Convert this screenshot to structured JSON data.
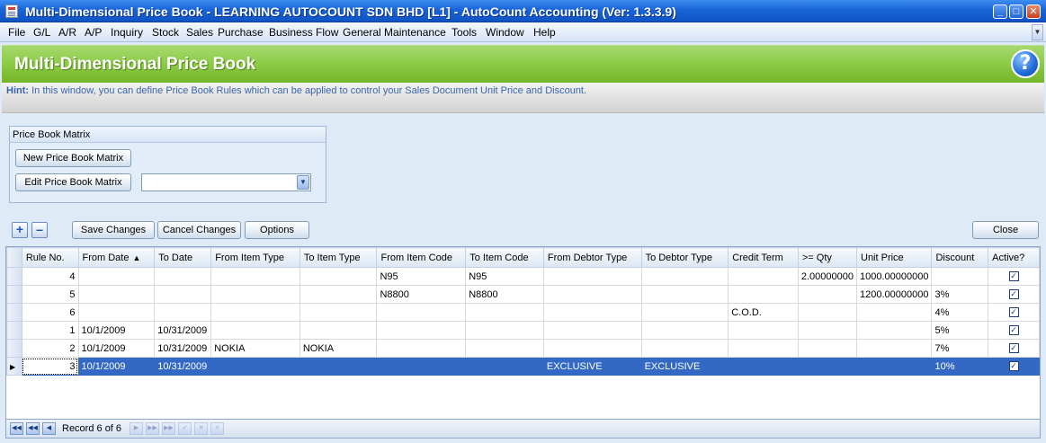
{
  "window": {
    "title": "Multi-Dimensional Price Book - LEARNING AUTOCOUNT SDN BHD [L1] - AutoCount Accounting (Ver: 1.3.3.9)"
  },
  "menu": [
    {
      "label": "File"
    },
    {
      "label": "G/L"
    },
    {
      "label": "A/R"
    },
    {
      "label": "A/P"
    },
    {
      "label": "Inquiry"
    },
    {
      "label": "Stock"
    },
    {
      "label": "Sales"
    },
    {
      "label": "Purchase"
    },
    {
      "label": "Business Flow"
    },
    {
      "label": "General Maintenance"
    },
    {
      "label": "Tools"
    },
    {
      "label": "Window"
    },
    {
      "label": "Help"
    }
  ],
  "header": {
    "title": "Multi-Dimensional Price Book",
    "hint_label": "Hint:",
    "hint_text": "In this window, you can define Price Book Rules which can be applied to control your Sales Document Unit Price and Discount."
  },
  "matrix": {
    "group_title": "Price Book Matrix",
    "new_button": "New Price Book Matrix",
    "edit_button": "Edit Price Book Matrix",
    "selected_matrix": ""
  },
  "toolbar": {
    "add_symbol": "+",
    "remove_symbol": "–",
    "save": "Save Changes",
    "cancel": "Cancel Changes",
    "options": "Options",
    "close": "Close"
  },
  "grid": {
    "columns": [
      "Rule No.",
      "From Date",
      "To Date",
      "From Item Type",
      "To Item Type",
      "From Item Code",
      "To Item Code",
      "From Debtor Type",
      "To Debtor Type",
      "Credit Term",
      ">= Qty",
      "Unit Price",
      "Discount",
      "Active?"
    ],
    "rows": [
      {
        "rule": "4",
        "from_date": "",
        "to_date": "",
        "from_item_type": "",
        "to_item_type": "",
        "from_item_code": "N95",
        "to_item_code": "N95",
        "from_debtor_type": "",
        "to_debtor_type": "",
        "credit_term": "",
        "qty": "2.00000000",
        "unit_price": "1000.00000000",
        "discount": "",
        "active": true
      },
      {
        "rule": "5",
        "from_date": "",
        "to_date": "",
        "from_item_type": "",
        "to_item_type": "",
        "from_item_code": "N8800",
        "to_item_code": "N8800",
        "from_debtor_type": "",
        "to_debtor_type": "",
        "credit_term": "",
        "qty": "",
        "unit_price": "1200.00000000",
        "discount": "3%",
        "active": true
      },
      {
        "rule": "6",
        "from_date": "",
        "to_date": "",
        "from_item_type": "",
        "to_item_type": "",
        "from_item_code": "",
        "to_item_code": "",
        "from_debtor_type": "",
        "to_debtor_type": "",
        "credit_term": "C.O.D.",
        "qty": "",
        "unit_price": "",
        "discount": "4%",
        "active": true
      },
      {
        "rule": "1",
        "from_date": "10/1/2009",
        "to_date": "10/31/2009",
        "from_item_type": "",
        "to_item_type": "",
        "from_item_code": "",
        "to_item_code": "",
        "from_debtor_type": "",
        "to_debtor_type": "",
        "credit_term": "",
        "qty": "",
        "unit_price": "",
        "discount": "5%",
        "active": true
      },
      {
        "rule": "2",
        "from_date": "10/1/2009",
        "to_date": "10/31/2009",
        "from_item_type": "NOKIA",
        "to_item_type": "NOKIA",
        "from_item_code": "",
        "to_item_code": "",
        "from_debtor_type": "",
        "to_debtor_type": "",
        "credit_term": "",
        "qty": "",
        "unit_price": "",
        "discount": "7%",
        "active": true
      },
      {
        "rule": "3",
        "from_date": "10/1/2009",
        "to_date": "10/31/2009",
        "from_item_type": "",
        "to_item_type": "",
        "from_item_code": "",
        "to_item_code": "",
        "from_debtor_type": "EXCLUSIVE",
        "to_debtor_type": "EXCLUSIVE",
        "credit_term": "",
        "qty": "",
        "unit_price": "",
        "discount": "10%",
        "active": true
      }
    ],
    "selected_index": 5
  },
  "navigator": {
    "record_text": "Record 6 of 6"
  }
}
